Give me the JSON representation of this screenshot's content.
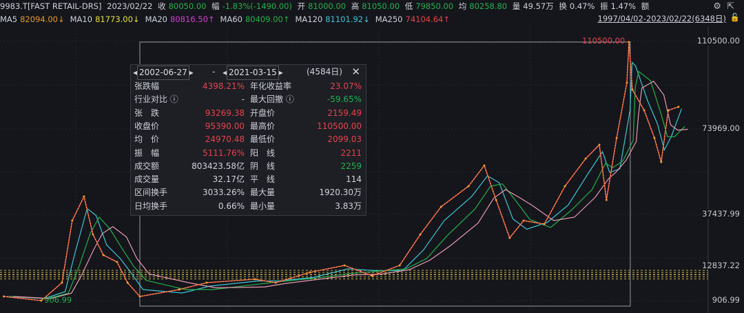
{
  "header": {
    "symbol": "9983.T[FAST RETAIL-DRS]",
    "date": "2023/02/22",
    "close_label": "收",
    "close": "80050.00",
    "chg_label": "幅",
    "chg": "-1.83%(-1490.00)",
    "open_label": "开",
    "open": "81000.00",
    "high_label": "高",
    "high": "81050.00",
    "low_label": "低",
    "low": "79850.00",
    "avg_label": "均",
    "avg": "80258.80",
    "vol_label": "量",
    "vol": "49.57万",
    "turn_label": "换",
    "turn": "0.47%",
    "amp_label": "振",
    "amp": "1.47%",
    "amt_label": "额"
  },
  "ma": [
    {
      "label": "MA5",
      "value": "82094.00↓",
      "color": "#e89a2c"
    },
    {
      "label": "MA10",
      "value": "81773.00↓",
      "color": "#e6e03a"
    },
    {
      "label": "MA20",
      "value": "80816.50↑",
      "color": "#d63fd6"
    },
    {
      "label": "MA60",
      "value": "80409.00↑",
      "color": "#23b14d"
    },
    {
      "label": "MA120",
      "value": "81101.92↓",
      "color": "#3fc6d6"
    },
    {
      "label": "MA250",
      "value": "74104.64↑",
      "color": "#e8424c"
    }
  ],
  "range_label": "1997/04/02-2023/02/22(6348日)",
  "panel": {
    "start": "2002-06-27",
    "end": "2021-03-15",
    "days": "(4584日)",
    "sep": "-",
    "rows": [
      {
        "l": "张跌幅",
        "v": "4398.21%",
        "vc": "r",
        "l2": "年化收益率",
        "v2": "23.07%",
        "v2c": "r"
      },
      {
        "l": "行业对比 ⓘ",
        "v": "-",
        "vc": "w",
        "l2": "最大回撤 ⓘ",
        "v2": "-59.65%",
        "v2c": "g"
      },
      {
        "l": "张　跌",
        "v": "93269.38",
        "vc": "r",
        "l2": "开盘价",
        "v2": "2159.49",
        "v2c": "r"
      },
      {
        "l": "收盘价",
        "v": "95390.00",
        "vc": "r",
        "l2": "最高价",
        "v2": "110500.00",
        "v2c": "r"
      },
      {
        "l": "均　价",
        "v": "24970.48",
        "vc": "r",
        "l2": "最低价",
        "v2": "2099.03",
        "v2c": "r"
      },
      {
        "l": "振　幅",
        "v": "5111.76%",
        "vc": "r",
        "l2": "阳　线",
        "v2": "2211",
        "v2c": "r"
      },
      {
        "l": "成交额",
        "v": "803423.58亿",
        "vc": "w",
        "l2": "阴　线",
        "v2": "2259",
        "v2c": "g"
      },
      {
        "l": "成交量",
        "v": "32.17亿",
        "vc": "w",
        "l2": "平　线",
        "v2": "114",
        "v2c": "w"
      },
      {
        "l": "区间换手",
        "v": "3033.26%",
        "vc": "w",
        "l2": "最大量",
        "v2": "1920.30万",
        "v2c": "w"
      },
      {
        "l": "日均换手",
        "v": "0.66%",
        "vc": "w",
        "l2": "最小量",
        "v2": "3.83万",
        "v2c": "w"
      }
    ]
  },
  "chart_data": {
    "type": "line",
    "title": "",
    "ylim": [
      906.99,
      110500
    ],
    "y_ticks": [
      "110500.00",
      "73969.00",
      "37437.99",
      "906.99"
    ],
    "ref_lines": [
      {
        "value": 12837.22,
        "label": "12837.22"
      },
      {
        "value": 10963,
        "label": ""
      }
    ],
    "annotations": {
      "max_label": "110500.00",
      "min_label": "906.99"
    },
    "x": [
      1997.3,
      1998.73,
      1999.52,
      1999.91,
      2000.36,
      2000.7,
      2001.1,
      2001.62,
      2002.02,
      2002.49,
      2003.99,
      2005.04,
      2006.88,
      2007.67,
      2008.98,
      2010.3,
      2011.35,
      2012.4,
      2013.19,
      2013.98,
      2015.03,
      2015.63,
      2016.08,
      2016.6,
      2017.13,
      2017.92,
      2018.71,
      2019.5,
      2020.02,
      2020.29,
      2020.68,
      2021.07,
      2021.15,
      2021.28,
      2021.73,
      2022.12,
      2022.38,
      2022.65,
      2023.04
    ],
    "values": [
      2660,
      906.99,
      8506,
      34808,
      45037,
      28963,
      20196,
      17273,
      8506,
      2660,
      5583,
      8506,
      9967,
      8506,
      12889,
      15812,
      11428,
      15812,
      28963,
      40653,
      49421,
      58188,
      43576,
      27502,
      34808,
      33347,
      49421,
      61110,
      66955,
      43576,
      69878,
      93258,
      110500,
      90335,
      81568,
      69878,
      59649,
      81568,
      83030
    ],
    "selection": [
      2002.49,
      2021.2
    ]
  }
}
